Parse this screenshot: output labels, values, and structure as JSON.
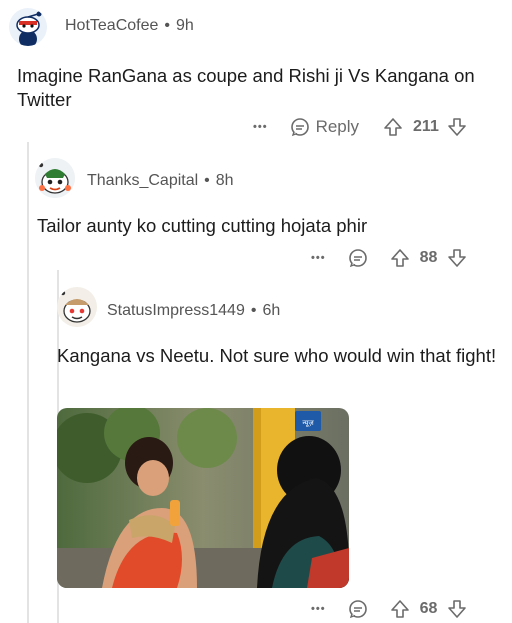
{
  "comments": [
    {
      "username": "HotTeaCofee",
      "separator": "•",
      "time": "9h",
      "text": "Imagine RanGana as coupe and Rishi ji Vs Kangana on Twitter",
      "reply_label": "Reply",
      "votes": "211",
      "more": "•••"
    },
    {
      "username": "Thanks_Capital",
      "separator": "•",
      "time": "8h",
      "text": "Tailor aunty ko cutting cutting hojata phir",
      "votes": "88",
      "more": "•••"
    },
    {
      "username": "StatusImpress1449",
      "separator": "•",
      "time": "6h",
      "text": "Kangana vs Neetu. Not sure who would win that fight!",
      "votes": "68",
      "more": "•••",
      "media_watermark": "न्यूज़"
    }
  ],
  "colors": {
    "thread_line": "#e3e3e3",
    "muted_text": "#6b6b6b",
    "body_text": "#1c1c1c"
  }
}
